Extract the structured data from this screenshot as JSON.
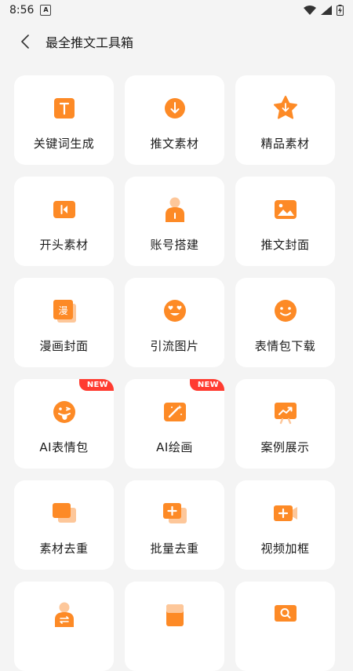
{
  "status_bar": {
    "time": "8:56",
    "notif_letter": "A"
  },
  "header": {
    "title": "最全推文工具箱"
  },
  "cards": [
    {
      "label": "关键词生成",
      "icon": "text-t-icon"
    },
    {
      "label": "推文素材",
      "icon": "download-circle-icon"
    },
    {
      "label": "精品素材",
      "icon": "star-download-icon"
    },
    {
      "label": "开头素材",
      "icon": "skip-back-icon"
    },
    {
      "label": "账号搭建",
      "icon": "user-icon"
    },
    {
      "label": "推文封面",
      "icon": "image-icon"
    },
    {
      "label": "漫画封面",
      "icon": "comic-icon",
      "glyph": "漫"
    },
    {
      "label": "引流图片",
      "icon": "heart-eyes-emoji-icon"
    },
    {
      "label": "表情包下载",
      "icon": "smile-emoji-icon"
    },
    {
      "label": "AI表情包",
      "icon": "tongue-emoji-icon",
      "badge": "NEW"
    },
    {
      "label": "AI绘画",
      "icon": "magic-wand-icon",
      "badge": "NEW"
    },
    {
      "label": "案例展示",
      "icon": "presentation-chart-icon"
    },
    {
      "label": "素材去重",
      "icon": "copy-icon"
    },
    {
      "label": "批量去重",
      "icon": "plus-stack-icon"
    },
    {
      "label": "视频加框",
      "icon": "video-plus-icon"
    },
    {
      "label": "",
      "icon": "user-swap-icon"
    },
    {
      "label": "",
      "icon": "book-icon"
    },
    {
      "label": "",
      "icon": "search-board-icon"
    }
  ],
  "colors": {
    "accent": "#fd8a26",
    "accent_light": "#fdc79a",
    "badge": "#ff3b30"
  }
}
